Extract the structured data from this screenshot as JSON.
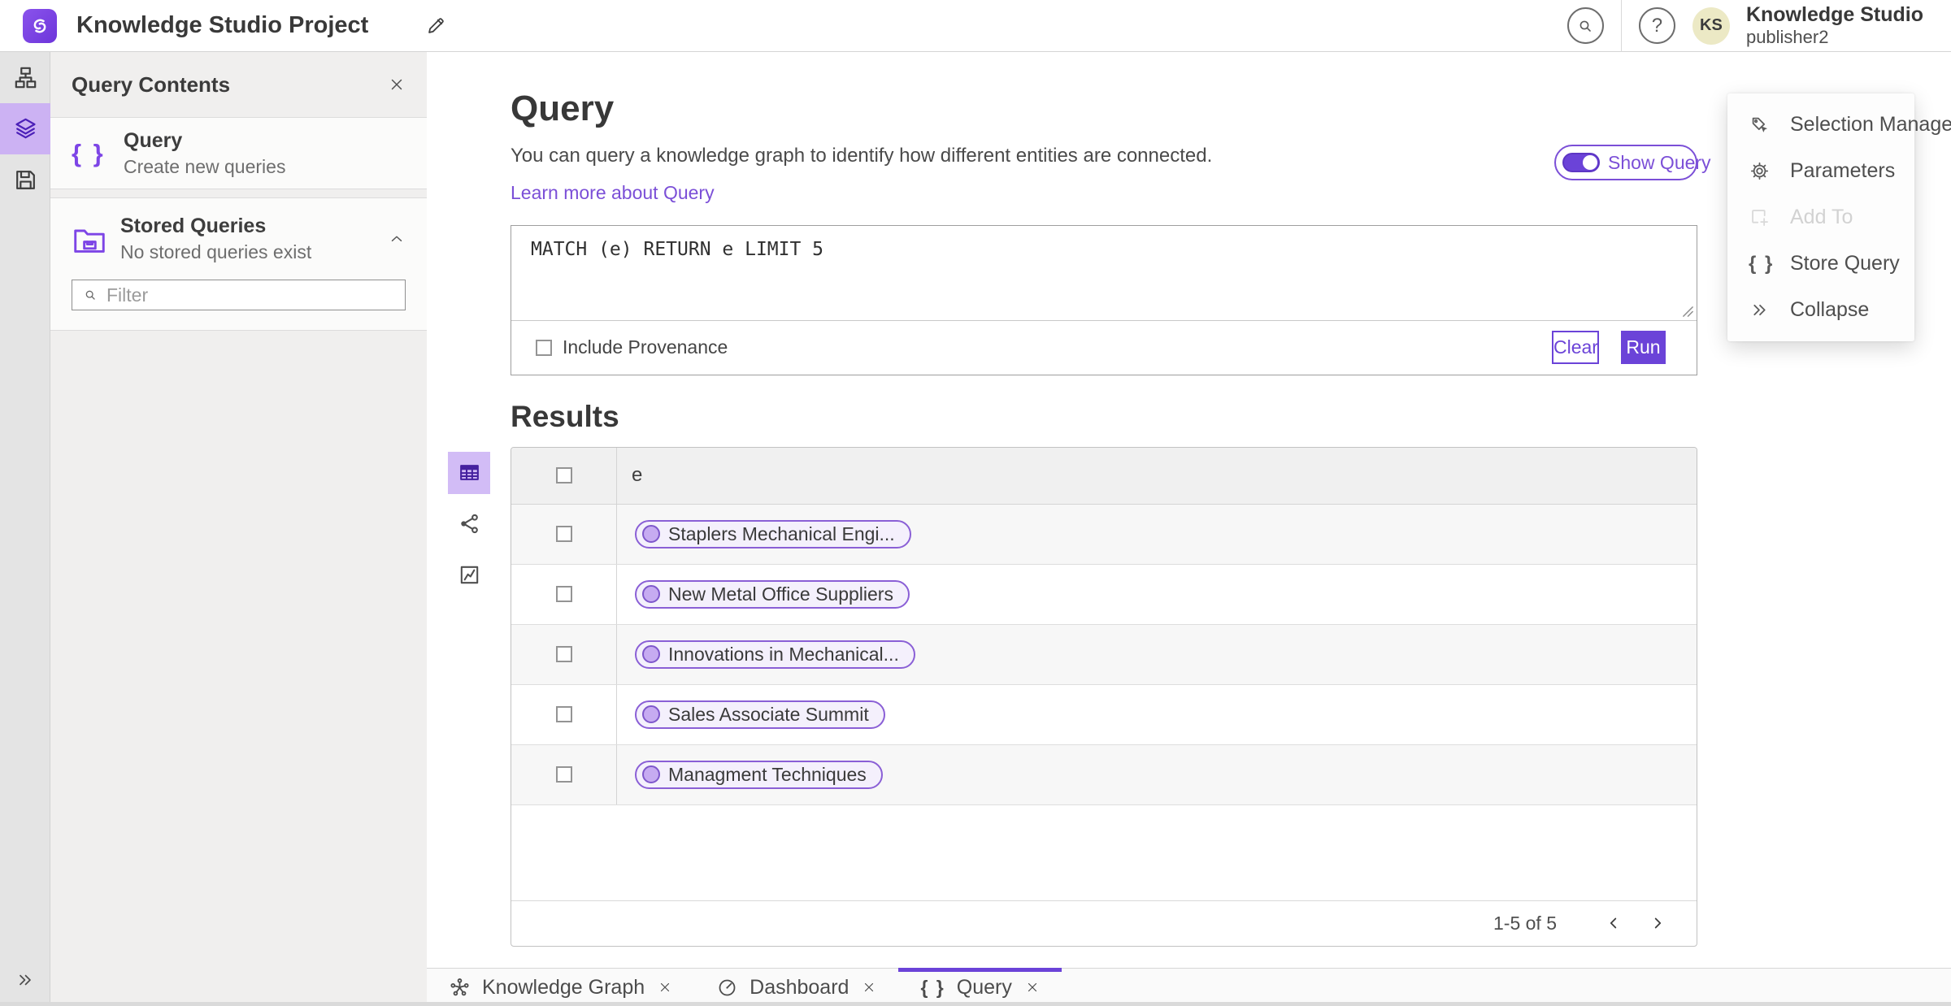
{
  "colors": {
    "accent": "#6b43d8",
    "accent_light": "#ccb2f3",
    "link": "#7b4fd7",
    "chip_bg": "#f4f0fc",
    "chip_border": "#8a5fd6",
    "avatar_bg": "#ece9c5"
  },
  "topbar": {
    "title": "Knowledge Studio Project",
    "user_initials": "KS",
    "user_name": "Knowledge Studio",
    "user_role": "publisher2"
  },
  "sidebar": {
    "title": "Query Contents",
    "query_item": {
      "title": "Query",
      "subtitle": "Create new queries"
    },
    "stored_item": {
      "title": "Stored Queries",
      "subtitle": "No stored queries exist"
    },
    "filter_placeholder": "Filter"
  },
  "query": {
    "heading": "Query",
    "description": "You can query a knowledge graph to identify how different entities are connected.",
    "learn_more": "Learn more about Query",
    "show_query": "Show Query",
    "text": "MATCH (e) RETURN e LIMIT 5",
    "include_provenance": "Include Provenance",
    "clear": "Clear",
    "run": "Run"
  },
  "results": {
    "heading": "Results",
    "column": "e",
    "rows": [
      "Staplers Mechanical Engi...",
      "New Metal Office Suppliers",
      "Innovations in Mechanical...",
      "Sales Associate Summit",
      "Managment Techniques"
    ],
    "pagination": "1-5 of 5"
  },
  "tools": {
    "items": [
      {
        "label": "Selection Manager"
      },
      {
        "label": "Parameters"
      },
      {
        "label": "Add To"
      },
      {
        "label": "Store Query"
      },
      {
        "label": "Collapse"
      }
    ]
  },
  "tabs": [
    {
      "label": "Knowledge Graph"
    },
    {
      "label": "Dashboard"
    },
    {
      "label": "Query"
    }
  ]
}
